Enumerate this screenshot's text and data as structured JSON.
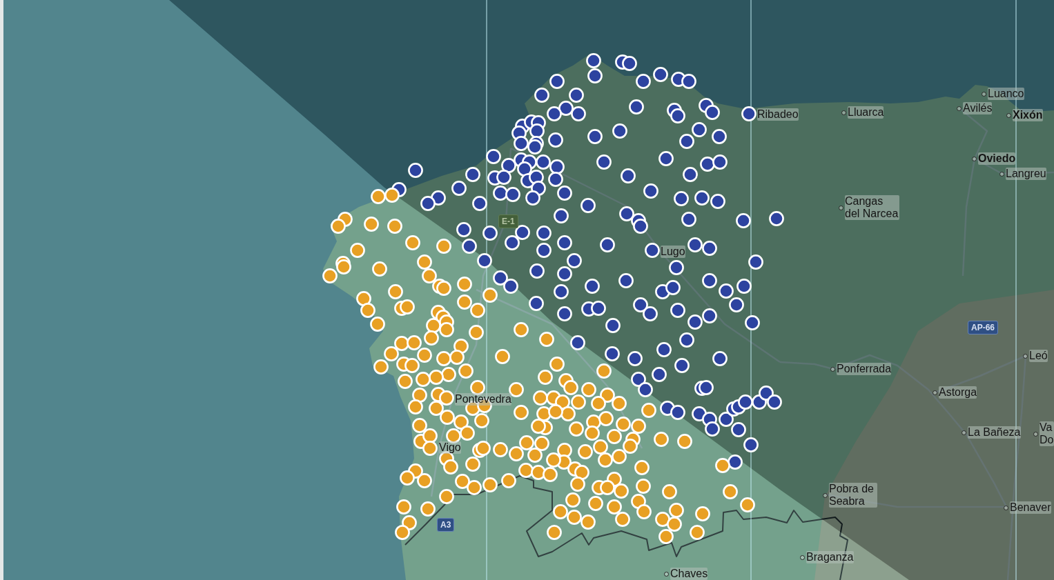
{
  "map": {
    "places": [
      {
        "name": "Luanco",
        "kind": "town"
      },
      {
        "name": "Ribadeo",
        "kind": "plain"
      },
      {
        "name": "Lluarca",
        "kind": "town"
      },
      {
        "name": "Avilés",
        "kind": "town"
      },
      {
        "name": "Xixón",
        "kind": "city"
      },
      {
        "name": "Oviedo",
        "kind": "city"
      },
      {
        "name": "Langreu",
        "kind": "town"
      },
      {
        "name": "Cangas del Narcea",
        "kind": "town"
      },
      {
        "name": "Lugo",
        "kind": "plain"
      },
      {
        "name": "Leó",
        "kind": "town"
      },
      {
        "name": "Ponferrada",
        "kind": "town"
      },
      {
        "name": "Astorga",
        "kind": "town"
      },
      {
        "name": "Pontevedra",
        "kind": "plain"
      },
      {
        "name": "La Bañeza",
        "kind": "town"
      },
      {
        "name": "Va Do",
        "kind": "town"
      },
      {
        "name": "Vigo",
        "kind": "plain"
      },
      {
        "name": "Pobra de Seabra",
        "kind": "town"
      },
      {
        "name": "Benaver",
        "kind": "town"
      },
      {
        "name": "Braganza",
        "kind": "town"
      },
      {
        "name": "Chaves",
        "kind": "town"
      }
    ],
    "road_signs": [
      {
        "label": "E-1",
        "kind": "european"
      },
      {
        "label": "AP-66",
        "kind": "motorway"
      },
      {
        "label": "A3",
        "kind": "motorway"
      }
    ],
    "marker_groups": [
      {
        "color": "#2d43a0"
      },
      {
        "color": "#e8a024"
      }
    ]
  }
}
